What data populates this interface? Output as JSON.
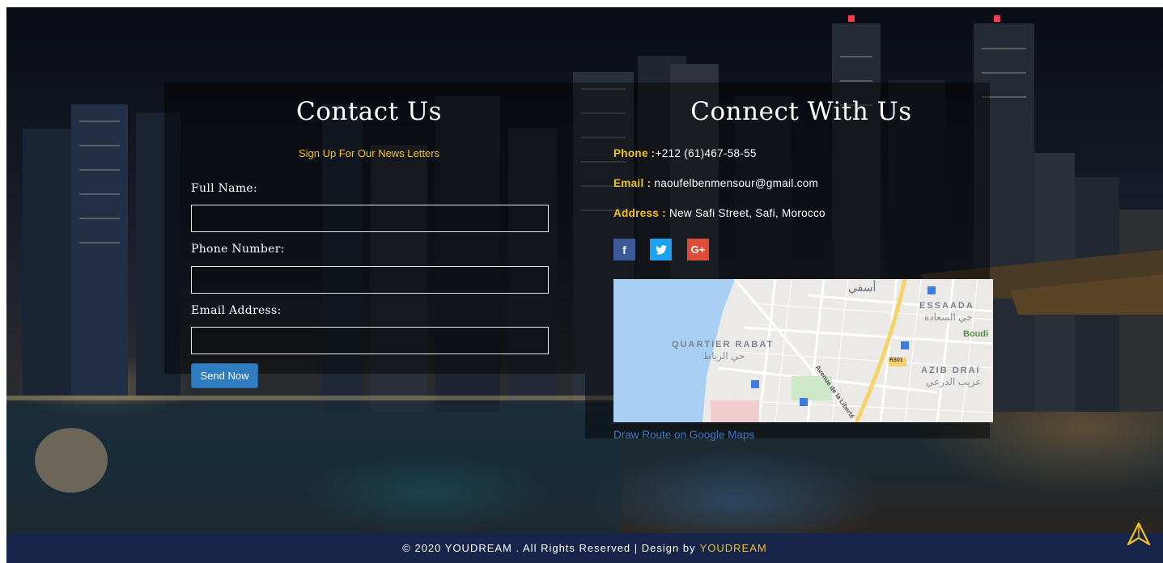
{
  "contact": {
    "title": "Contact Us",
    "subtitle": "Sign Up For Our News Letters",
    "full_name_label": "Full Name:",
    "full_name_value": "",
    "phone_label": "Phone Number:",
    "phone_value": "",
    "email_label": "Email Address:",
    "email_value": "",
    "send_label": "Send Now"
  },
  "connect": {
    "title": "Connect With Us",
    "phone_key": "Phone :",
    "phone_value": "+212 (61)467-58-55",
    "email_key": "Email :",
    "email_value": " naoufelbenmensour@gmail.com",
    "address_key": "Address :",
    "address_value": " New Safi Street, Safi, Morocco",
    "social": [
      {
        "icon": "facebook-icon",
        "glyph": "f"
      },
      {
        "icon": "twitter-icon",
        "glyph": "🐦"
      },
      {
        "icon": "google-plus-icon",
        "glyph": "G+"
      }
    ],
    "map": {
      "labels": [
        "QUARTIER RABAT",
        "ESSAADA",
        "AZIB DRAI",
        "Boudi",
        "R301",
        "Avenue de la Liberté"
      ],
      "arabic_labels": [
        "حي الرباط",
        "حي السعادة",
        "عزيب الدرعي",
        "أسفي"
      ]
    },
    "route_link": "Draw Route on Google Maps"
  },
  "footer": {
    "text": "© 2020 YOUDREAM . All Rights Reserved | Design by",
    "brand": "YOUDREAM"
  },
  "colors": {
    "accent": "#f3c21b",
    "footer_bg": "#17254a",
    "button_bg": "#2f7cc1",
    "link": "#3a7bc6"
  }
}
